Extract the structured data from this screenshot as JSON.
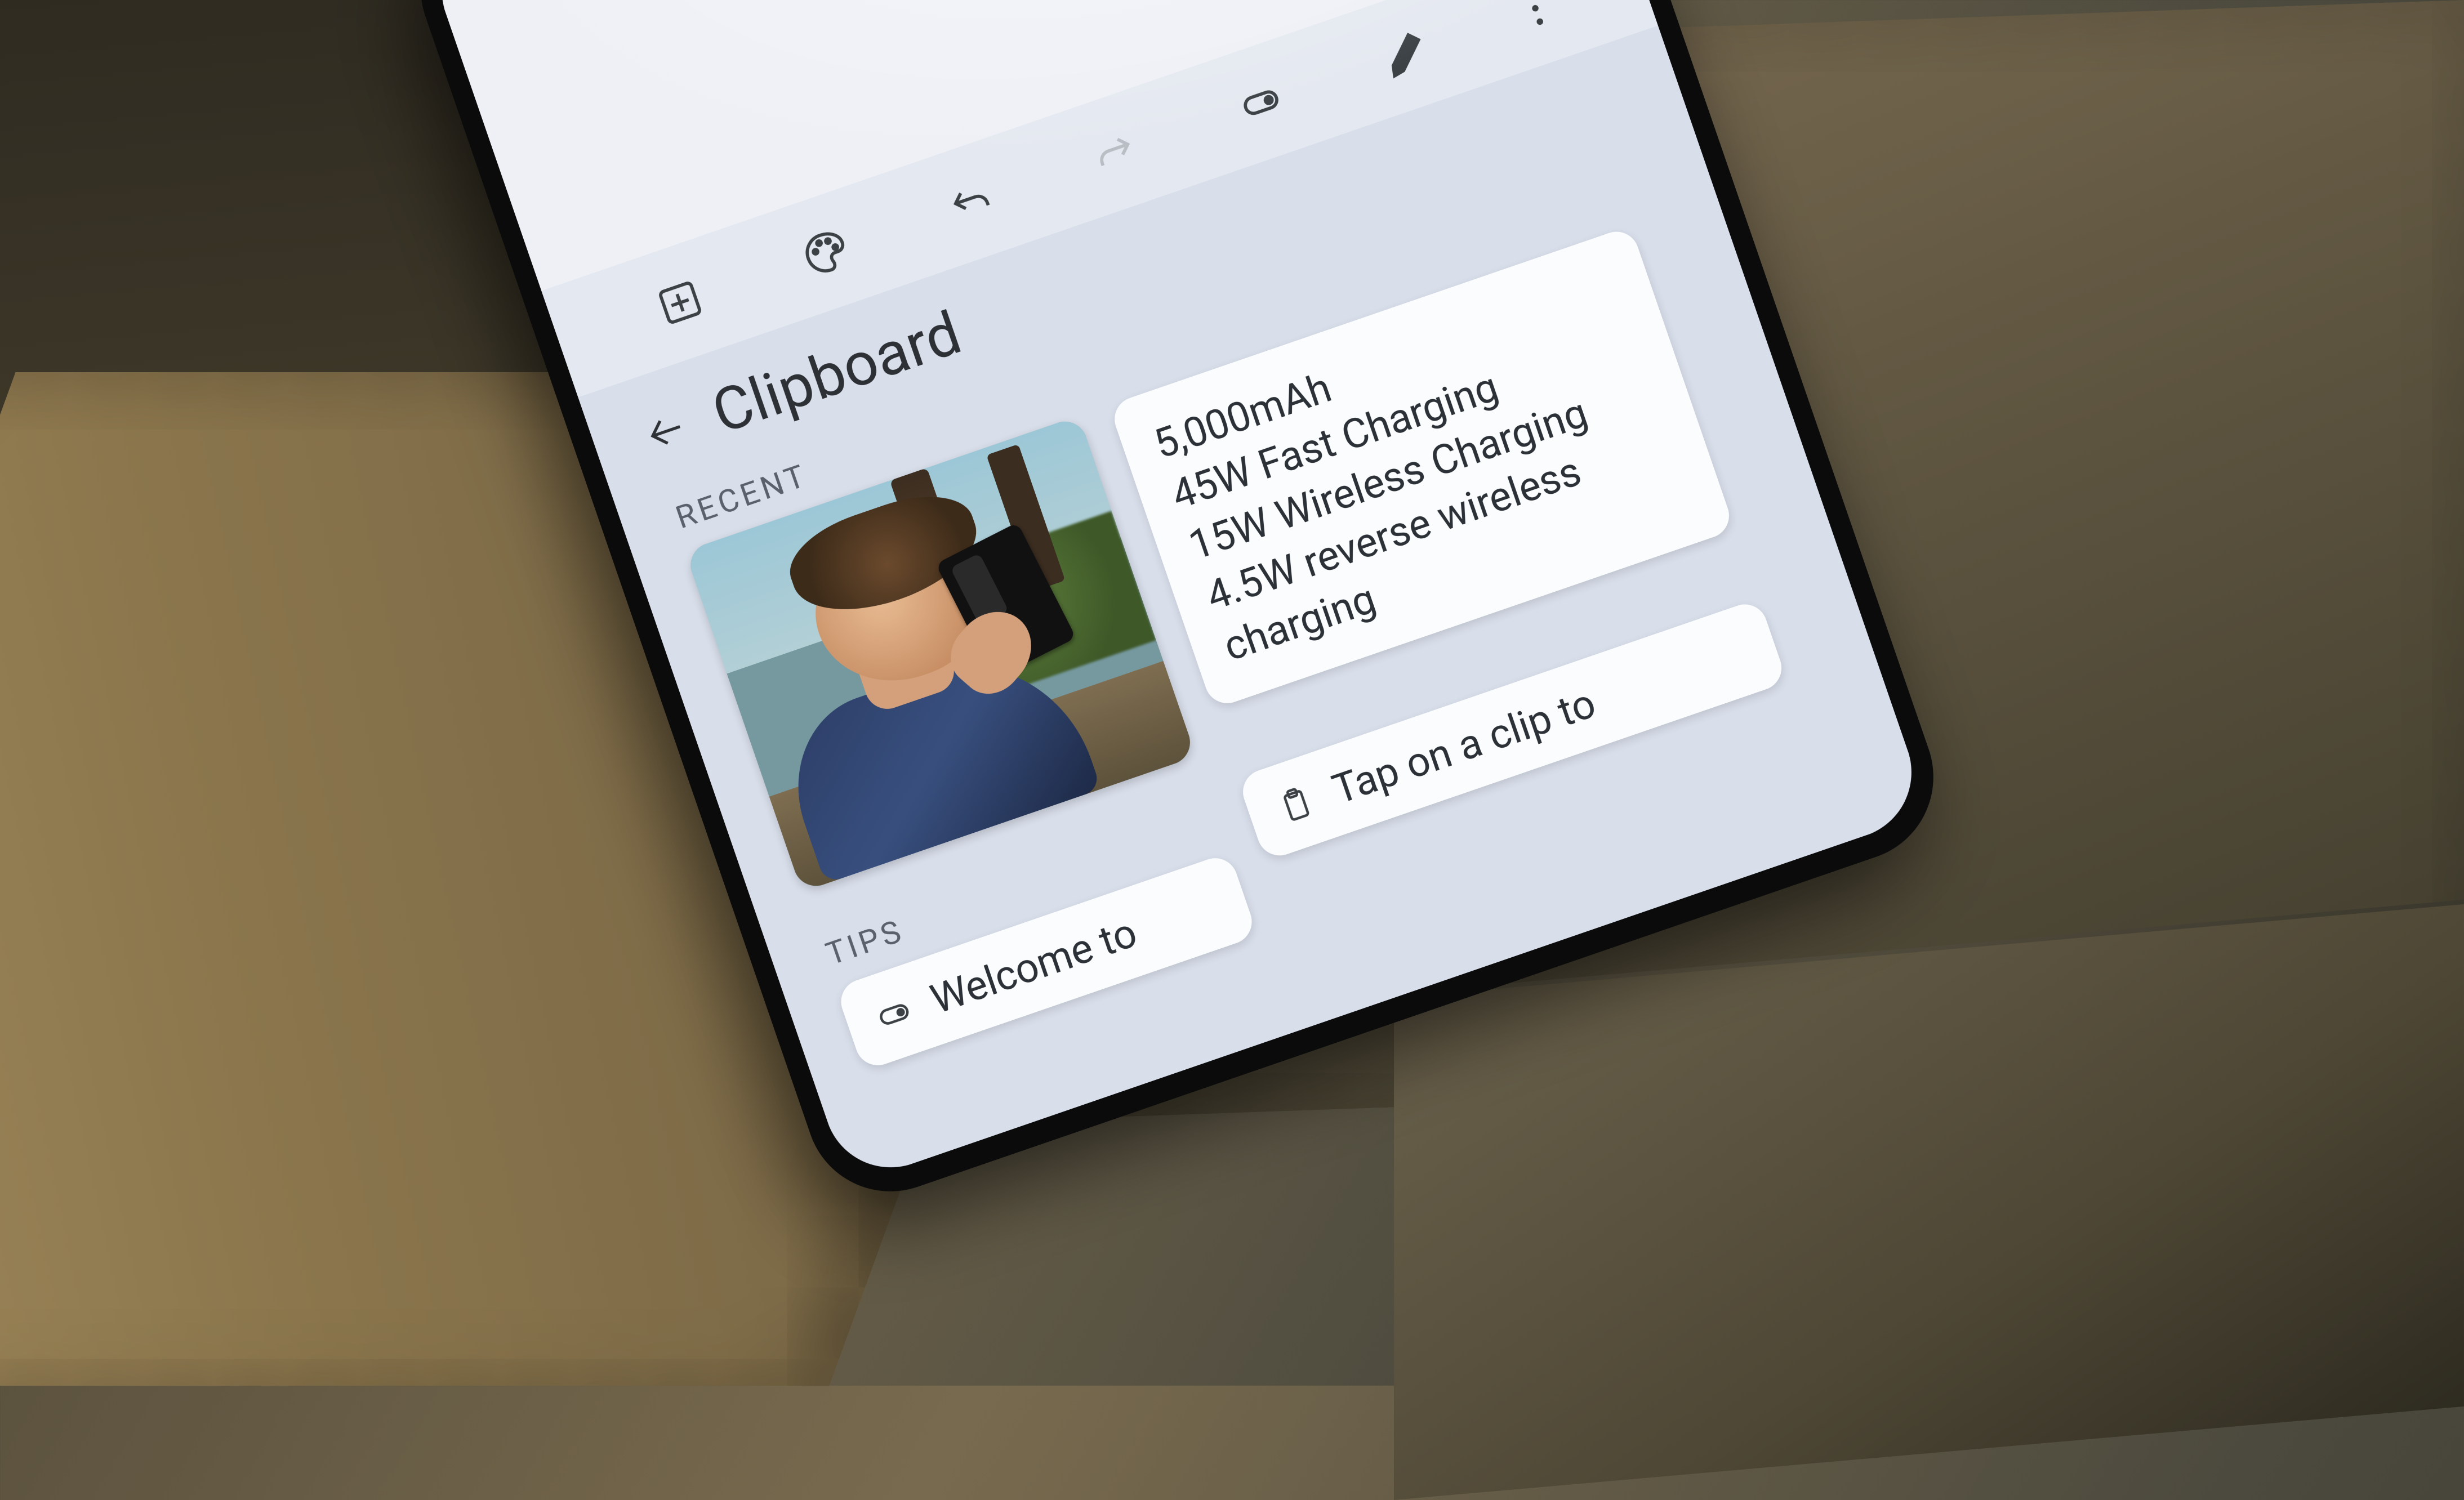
{
  "toolbar": {
    "add_name": "add",
    "palette_name": "palette",
    "undo_name": "undo",
    "redo_name": "redo",
    "toggle_name": "toggle",
    "edit_name": "edit",
    "more_name": "more"
  },
  "clipboard": {
    "title": "Clipboard",
    "sections": {
      "recent": "RECENT",
      "tips": "TIPS"
    },
    "recent": {
      "image_alt": "Photo clip: man holding phone",
      "text_lines": [
        "5,000mAh",
        "45W Fast Charging",
        "15W Wireless Charging",
        "4.5W reverse wireless",
        "charging"
      ]
    },
    "tips": {
      "card1": "Welcome to",
      "card2": "Tap on a clip to"
    }
  }
}
